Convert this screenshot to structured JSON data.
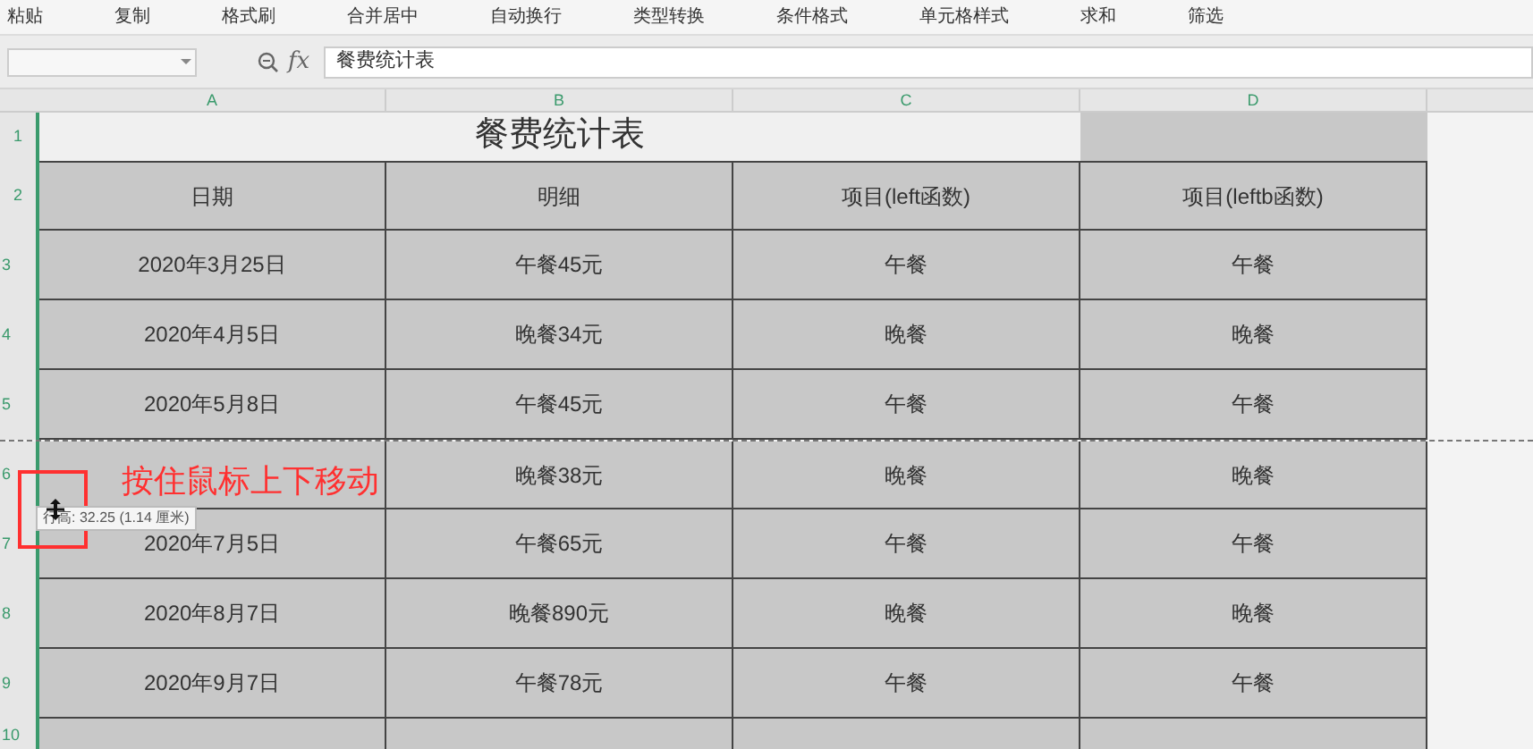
{
  "toolbar": [
    "粘贴",
    "复制",
    "格式刷",
    "合并居中",
    "自动换行",
    "类型转换",
    "条件格式",
    "单元格样式",
    "求和",
    "筛选"
  ],
  "formula_bar": {
    "icon_text": "fx",
    "formula": "餐费统计表"
  },
  "columns": [
    "A",
    "B",
    "C",
    "D"
  ],
  "sheet": {
    "title_row": "1",
    "title": "餐费统计表",
    "header_row": "2",
    "headers": [
      "日期",
      "明细",
      "项目(left函数)",
      "项目(leftb函数)"
    ],
    "rows": [
      {
        "row_number": "3",
        "cells": [
          "2020年3月25日",
          "午餐45元",
          "午餐",
          "午餐"
        ]
      },
      {
        "row_number": "4",
        "cells": [
          "2020年4月5日",
          "晚餐34元",
          "晚餐",
          "晚餐"
        ]
      },
      {
        "row_number": "5",
        "cells": [
          "2020年5月8日",
          "午餐45元",
          "午餐",
          "午餐"
        ]
      },
      {
        "row_number": "6",
        "cells": [
          "",
          "晚餐38元",
          "晚餐",
          "晚餐"
        ]
      },
      {
        "row_number": "7",
        "cells": [
          "2020年7月5日",
          "午餐65元",
          "午餐",
          "午餐"
        ]
      },
      {
        "row_number": "8",
        "cells": [
          "2020年8月7日",
          "晚餐890元",
          "晚餐",
          "晚餐"
        ]
      },
      {
        "row_number": "9",
        "cells": [
          "2020年9月7日",
          "午餐78元",
          "午餐",
          "午餐"
        ]
      },
      {
        "row_number": "10",
        "cells": [
          "",
          "",
          "",
          ""
        ]
      }
    ]
  },
  "annotation": "按住鼠标上下移动",
  "tooltip": "行高: 32.25 (1.14 厘米)"
}
